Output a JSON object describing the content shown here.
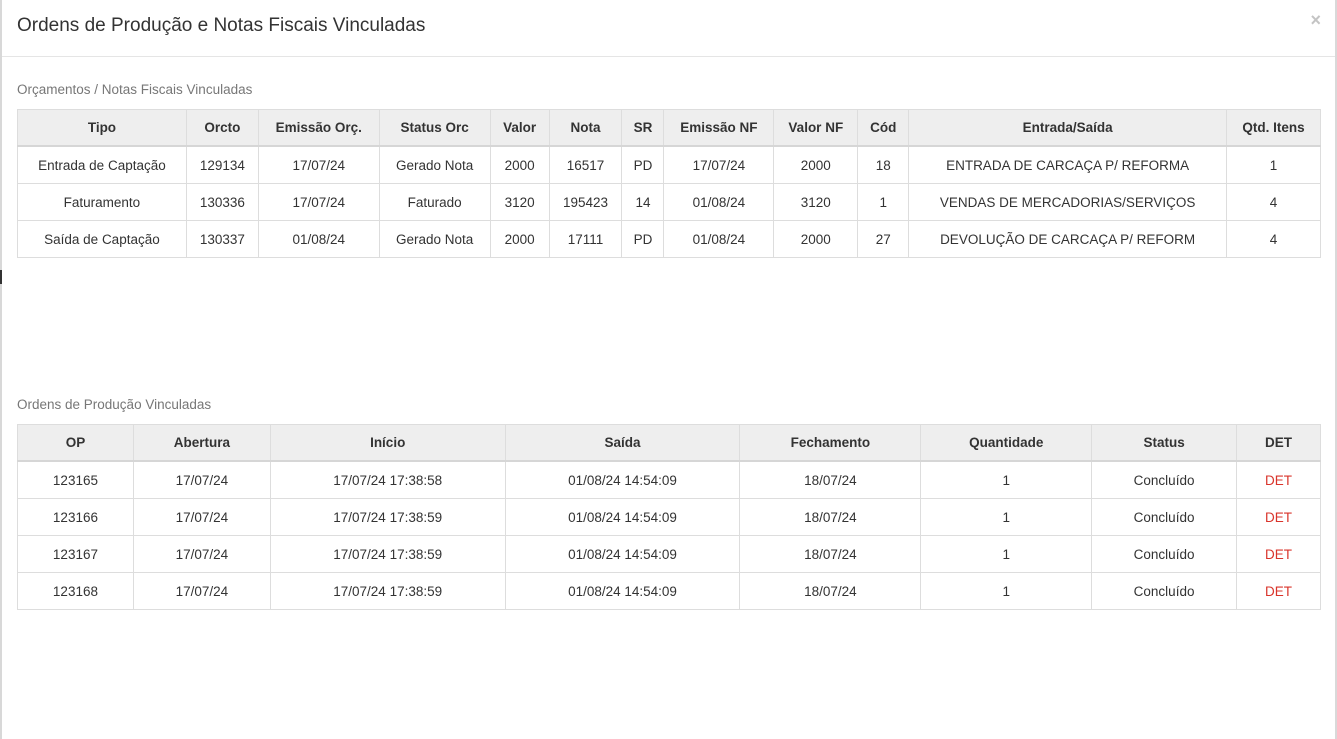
{
  "modal": {
    "title": "Ordens de Produção e Notas Fiscais Vinculadas",
    "close_label": "×"
  },
  "budgets": {
    "section_title": "Orçamentos / Notas Fiscais Vinculadas",
    "headers": [
      "Tipo",
      "Orcto",
      "Emissão Orç.",
      "Status Orc",
      "Valor",
      "Nota",
      "SR",
      "Emissão NF",
      "Valor NF",
      "Cód",
      "Entrada/Saída",
      "Qtd. Itens"
    ],
    "rows": [
      [
        "Entrada de Captação",
        "129134",
        "17/07/24",
        "Gerado Nota",
        "2000",
        "16517",
        "PD",
        "17/07/24",
        "2000",
        "18",
        "ENTRADA DE CARCAÇA P/ REFORMA",
        "1"
      ],
      [
        "Faturamento",
        "130336",
        "17/07/24",
        "Faturado",
        "3120",
        "195423",
        "14",
        "01/08/24",
        "3120",
        "1",
        "VENDAS DE MERCADORIAS/SERVIÇOS",
        "4"
      ],
      [
        "Saída de Captação",
        "130337",
        "01/08/24",
        "Gerado Nota",
        "2000",
        "17111",
        "PD",
        "01/08/24",
        "2000",
        "27",
        "DEVOLUÇÃO DE CARCAÇA P/ REFORM",
        "4"
      ]
    ]
  },
  "orders": {
    "section_title": "Ordens de Produção Vinculadas",
    "headers": [
      "OP",
      "Abertura",
      "Início",
      "Saída",
      "Fechamento",
      "Quantidade",
      "Status",
      "DET"
    ],
    "rows": [
      [
        "123165",
        "17/07/24",
        "17/07/24 17:38:58",
        "01/08/24 14:54:09",
        "18/07/24",
        "1",
        "Concluído",
        "DET"
      ],
      [
        "123166",
        "17/07/24",
        "17/07/24 17:38:59",
        "01/08/24 14:54:09",
        "18/07/24",
        "1",
        "Concluído",
        "DET"
      ],
      [
        "123167",
        "17/07/24",
        "17/07/24 17:38:59",
        "01/08/24 14:54:09",
        "18/07/24",
        "1",
        "Concluído",
        "DET"
      ],
      [
        "123168",
        "17/07/24",
        "17/07/24 17:38:59",
        "01/08/24 14:54:09",
        "18/07/24",
        "1",
        "Concluído",
        "DET"
      ]
    ]
  },
  "colors": {
    "det_link": "#d9342b",
    "header_bg": "#eeeeee",
    "section_label": "#777777"
  }
}
